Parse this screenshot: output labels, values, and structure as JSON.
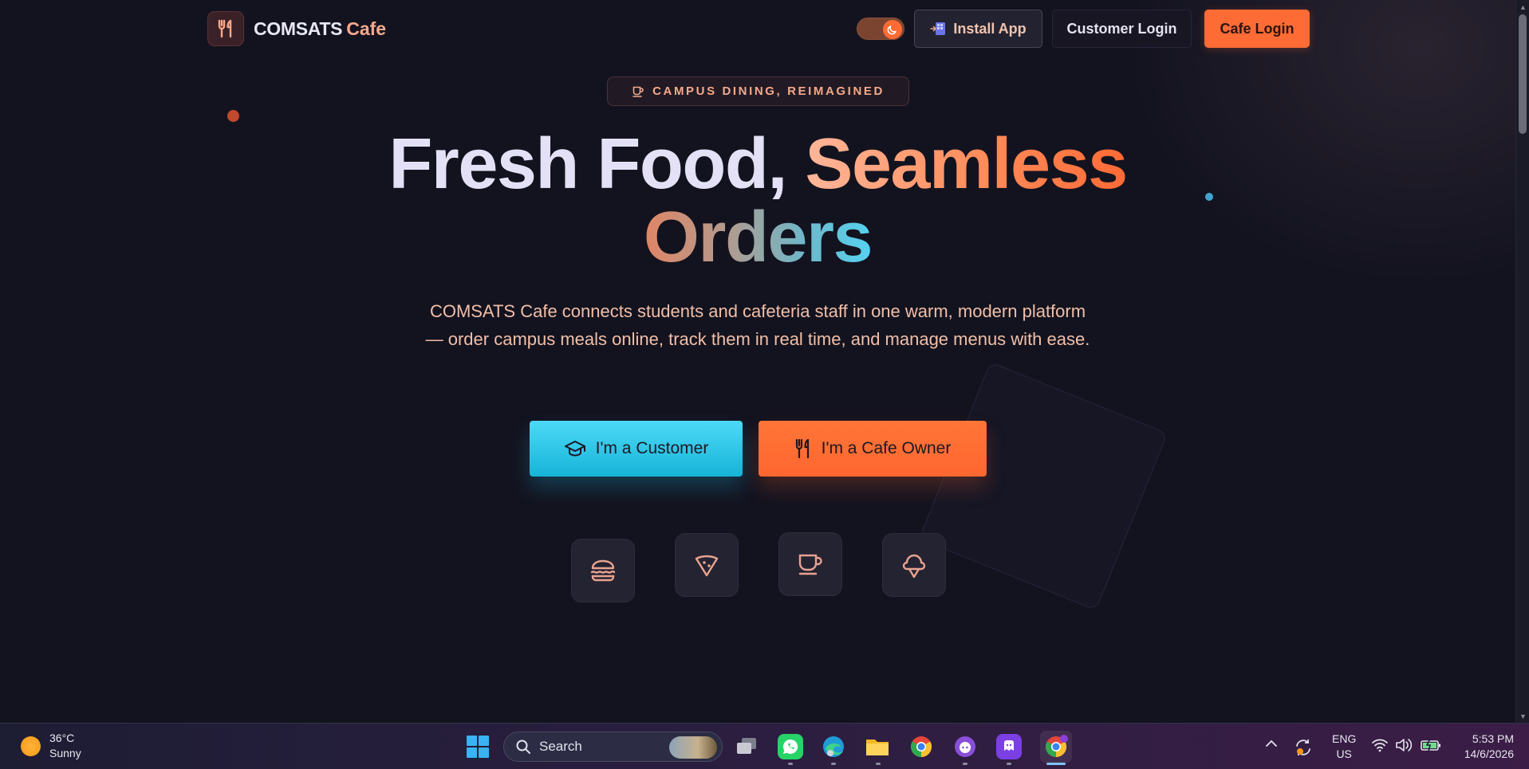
{
  "header": {
    "brand_name": "COMSATS",
    "brand_accent": "Cafe",
    "theme_toggle_state": "dark",
    "install_label": "Install App",
    "customer_login_label": "Customer Login",
    "cafe_login_label": "Cafe Login"
  },
  "hero": {
    "eyebrow": "CAMPUS DINING, REIMAGINED",
    "title_line1": "Fresh Food,",
    "title_highlight": "Seamless",
    "title_line2": "Orders",
    "description": "COMSATS Cafe connects students and cafeteria staff in one warm, modern platform — order campus meals online, track them in real time, and manage menus with ease.",
    "cta_customer": "I'm a Customer",
    "cta_owner": "I'm a Cafe Owner",
    "food_icons": [
      "burger-icon",
      "pizza-icon",
      "coffee-cup-icon",
      "ice-cream-icon"
    ]
  },
  "colors": {
    "accent_orange": "#ff6b35",
    "accent_cyan": "#22c0e3",
    "background": "#13131f",
    "text_peach": "#f1bfa8"
  },
  "taskbar": {
    "weather_temp": "36°C",
    "weather_desc": "Sunny",
    "search_placeholder": "Search",
    "apps": [
      "task-view",
      "whatsapp",
      "edge",
      "file-explorer",
      "chrome",
      "github-desktop",
      "app-purple",
      "chrome-active"
    ],
    "lang_line1": "ENG",
    "lang_line2": "US",
    "time": "5:53 PM",
    "date": "14/6/2026"
  }
}
